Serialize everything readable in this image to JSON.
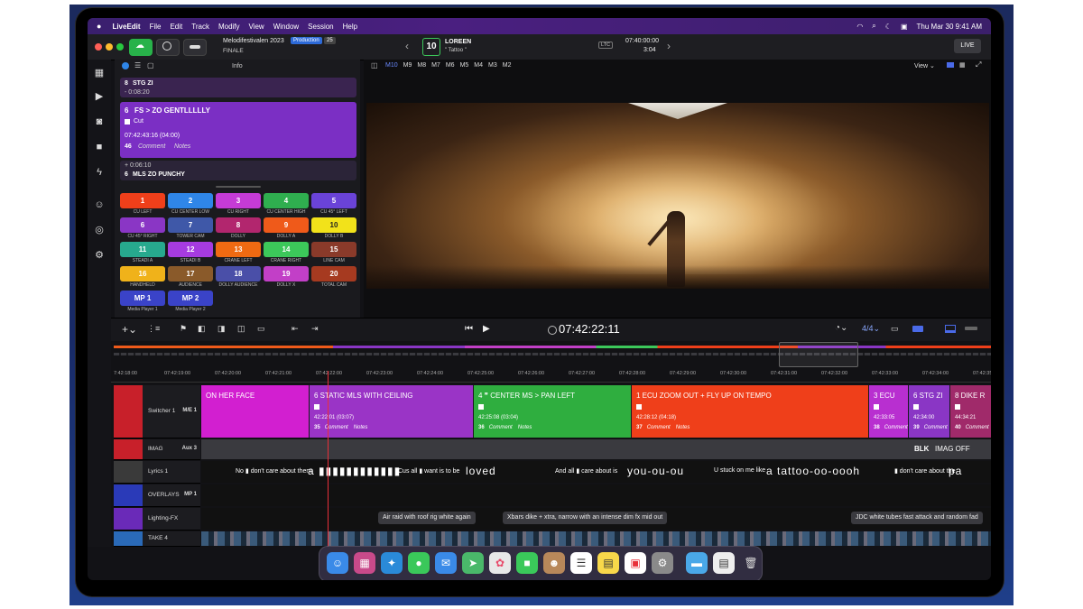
{
  "menubar": {
    "apple": "",
    "app": "LiveEdit",
    "items": [
      "File",
      "Edit",
      "Track",
      "Modify",
      "View",
      "Window",
      "Session",
      "Help"
    ],
    "datetime": "Thu Mar 30  9:41 AM"
  },
  "titlebar": {
    "project": "Melodifestivalen 2023",
    "badge": "Production",
    "badge_num": "25",
    "sub": "FINALE",
    "song_num": "10",
    "song_artist": "LOREEN",
    "song_title": "\" Tattoo \"",
    "ltc": "LTC",
    "tc_main": "07:40:00:00",
    "tc_sub": "3:04",
    "live": "LIVE"
  },
  "cuepanel": {
    "info_label": "Info",
    "prev_cue": {
      "num": "8",
      "title": "STG ZI",
      "dur": "- 0:08:20"
    },
    "current_cue": {
      "num": "6",
      "title": "FS > ZO GENTLLLLLY",
      "type": "Cut",
      "tc": "07:42:43:16  (04:00)",
      "count": "46",
      "comment": "Comment",
      "notes": "Notes"
    },
    "next_cue": {
      "dur": "+ 0:06:10",
      "num": "6",
      "title": "MLS ZO PUNCHY"
    }
  },
  "cams": [
    {
      "num": "1",
      "label": "CU LEFT",
      "color": "#ef3f1a"
    },
    {
      "num": "2",
      "label": "CU CENTER LOW",
      "color": "#2f86e8"
    },
    {
      "num": "3",
      "label": "CU RIGHT",
      "color": "#c53bd6"
    },
    {
      "num": "4",
      "label": "CU CENTER HIGH",
      "color": "#2fae4f"
    },
    {
      "num": "5",
      "label": "CU 45° LEFT",
      "color": "#6a43d8"
    },
    {
      "num": "6",
      "label": "CU 45° RIGHT",
      "color": "#8a36c5"
    },
    {
      "num": "7",
      "label": "TOWER CAM",
      "color": "#3f58a8"
    },
    {
      "num": "8",
      "label": "DOLLY",
      "color": "#b2266e"
    },
    {
      "num": "9",
      "label": "DOLLY A",
      "color": "#ef5a1a"
    },
    {
      "num": "10",
      "label": "DOLLY B",
      "color": "#f2e21a"
    },
    {
      "num": "11",
      "label": "STEADI A",
      "color": "#27a98e"
    },
    {
      "num": "12",
      "label": "STEADI B",
      "color": "#a63be0"
    },
    {
      "num": "13",
      "label": "CRANE LEFT",
      "color": "#f06a12"
    },
    {
      "num": "14",
      "label": "CRANE RIGHT",
      "color": "#3cc85a"
    },
    {
      "num": "15",
      "label": "LINE CAM",
      "color": "#8a3a2a"
    },
    {
      "num": "16",
      "label": "HANDHELD",
      "color": "#f0b21a"
    },
    {
      "num": "17",
      "label": "AUDIENCE",
      "color": "#8a5a2a"
    },
    {
      "num": "18",
      "label": "DOLLY AUDIENCE",
      "color": "#4a4fa8"
    },
    {
      "num": "19",
      "label": "DOLLY X",
      "color": "#c23fc7"
    },
    {
      "num": "20",
      "label": "TOTAL CAM",
      "color": "#a63a20"
    },
    {
      "num": "MP 1",
      "label": "Media Player 1",
      "color": "#3a43c8"
    },
    {
      "num": "MP 2",
      "label": "Media Player 2",
      "color": "#3a43c8"
    }
  ],
  "viewer": {
    "tabs": [
      "M10",
      "M9",
      "M8",
      "M7",
      "M6",
      "M5",
      "M4",
      "M3",
      "M2"
    ],
    "view_label": "View"
  },
  "transport": {
    "timecode": "07:42:22:11",
    "audio": "4/4"
  },
  "ruler": [
    "7:42:18:00",
    "07:42:19:00",
    "07:42:20:00",
    "07:42:21:00",
    "07:42:22:00",
    "07:42:23:00",
    "07:42:24:00",
    "07:42:25:00",
    "07:42:26:00",
    "07:42:27:00",
    "07:42:28:00",
    "07:42:29:00",
    "07:42:30:00",
    "07:42:31:00",
    "07:42:32:00",
    "07:42:33:00",
    "07:42:34:00",
    "07:42:35:00"
  ],
  "tracks": [
    {
      "name": "Switcher 1",
      "aux": "M/E 1",
      "chip": "#c8202a"
    },
    {
      "name": "IMAG",
      "aux": "Aux 3",
      "chip": "#c8202a"
    },
    {
      "name": "Lyrics 1",
      "aux": "",
      "chip": "#3a3a3a"
    },
    {
      "name": "OVERLAYS",
      "aux": "MP 1",
      "chip": "#2a3ab8"
    },
    {
      "name": "Lighting-FX",
      "aux": "",
      "chip": "#6a2ab8"
    },
    {
      "name": "TAKE 4",
      "aux": "",
      "chip": "#2a6ab8"
    }
  ],
  "clips": [
    {
      "title": "ON HER FACE",
      "color": "#d21fd0",
      "meta": "",
      "count": ""
    },
    {
      "title": "6  STATIC MLS WITH CEILING",
      "color": "#9a34c6",
      "meta": "42:22:01  (03:07)",
      "count": "35"
    },
    {
      "title": "4  ❞  CENTER MS > PAN LEFT",
      "color": "#2fae3f",
      "meta": "42:25:08  (03:04)",
      "count": "36"
    },
    {
      "title": "1  ECU  ZOOM OUT + FLY UP ON TEMPO",
      "color": "#ef3f1a",
      "meta": "42:28:12  (04:18)",
      "count": "37"
    },
    {
      "title": "3  ECU",
      "color": "#b82fd0",
      "meta": "42:33:05",
      "count": "38"
    },
    {
      "title": "6  STG ZI",
      "color": "#8a36c5",
      "meta": "42:34:00",
      "count": "39"
    },
    {
      "title": "8  DIKE R",
      "color": "#a02a6a",
      "meta": "44:34:21",
      "count": "40"
    }
  ],
  "clip_labels": {
    "comment": "Comment",
    "notes": "Notes"
  },
  "imag": {
    "blk": "BLK",
    "off": "IMAG OFF"
  },
  "lyrics": [
    "No  ▮ don't care about them",
    "a ▮▮▮▮▮▮▮▮▮▮▮▮",
    "Cus all ▮ want is to be",
    "loved",
    "And all ▮ care about is",
    "you-ou-ou",
    "U  stuck on me like",
    "a tattoo-oo-oooh",
    "▮ don't care about the",
    "pa"
  ],
  "lighting": [
    "Air raid with roof rig white again",
    "Xbars dike + xtra, narrow with an intense dim fx mid out",
    "JDC white tubes fast attack and random fad"
  ]
}
